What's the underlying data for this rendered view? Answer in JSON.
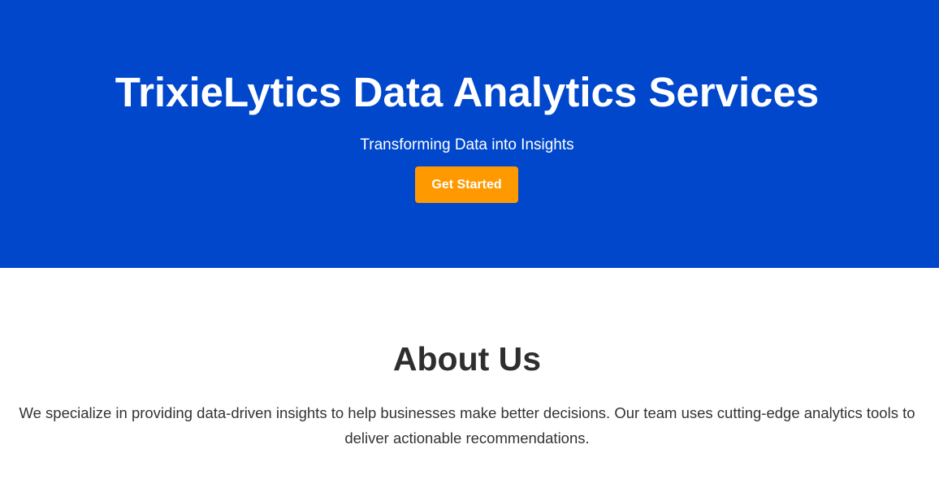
{
  "hero": {
    "title": "TrixieLytics Data Analytics Services",
    "subtitle": "Transforming Data into Insights",
    "cta_label": "Get Started",
    "background_color": "#0047cc",
    "cta_color": "#ff9900"
  },
  "about": {
    "heading": "About Us",
    "text": "We specialize in providing data-driven insights to help businesses make better decisions. Our team uses cutting-edge analytics tools to deliver actionable recommendations."
  }
}
